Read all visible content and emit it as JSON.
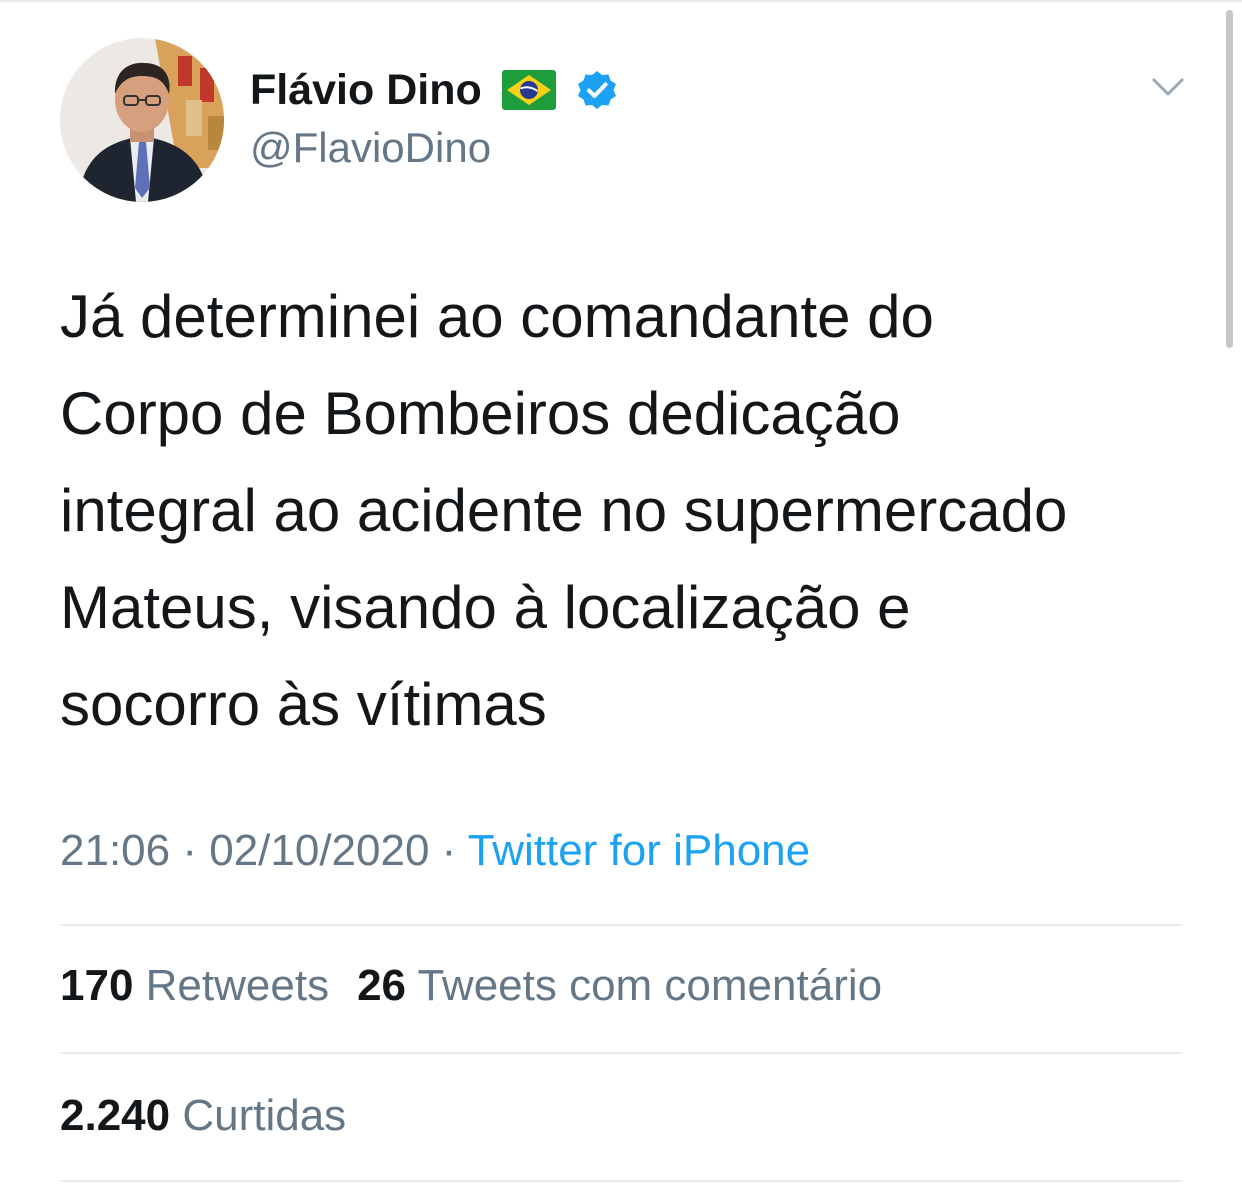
{
  "author": {
    "display_name": "Flávio Dino",
    "handle": "@FlavioDino",
    "avatar_icon": "profile-photo",
    "flag_icon": "brazil-flag-emoji",
    "verified_icon": "verified-badge-icon"
  },
  "tweet": {
    "text_lines": [
      "Já determinei ao comandante do",
      "Corpo de Bombeiros dedicação",
      "integral ao acidente no supermercado",
      "Mateus, visando à localização e",
      "socorro às vítimas"
    ]
  },
  "meta": {
    "time": "21:06",
    "separator": " · ",
    "date": "02/10/2020",
    "source": "Twitter for iPhone"
  },
  "stats": {
    "retweets_count": "170",
    "retweets_label": "Retweets",
    "quote_count": "26",
    "quote_label": "Tweets com comentário",
    "likes_count": "2.240",
    "likes_label": "Curtidas"
  },
  "colors": {
    "text": "#14171a",
    "secondary": "#657786",
    "link": "#1da1f2",
    "divider": "#e6ecf0",
    "verified": "#1da1f2"
  }
}
